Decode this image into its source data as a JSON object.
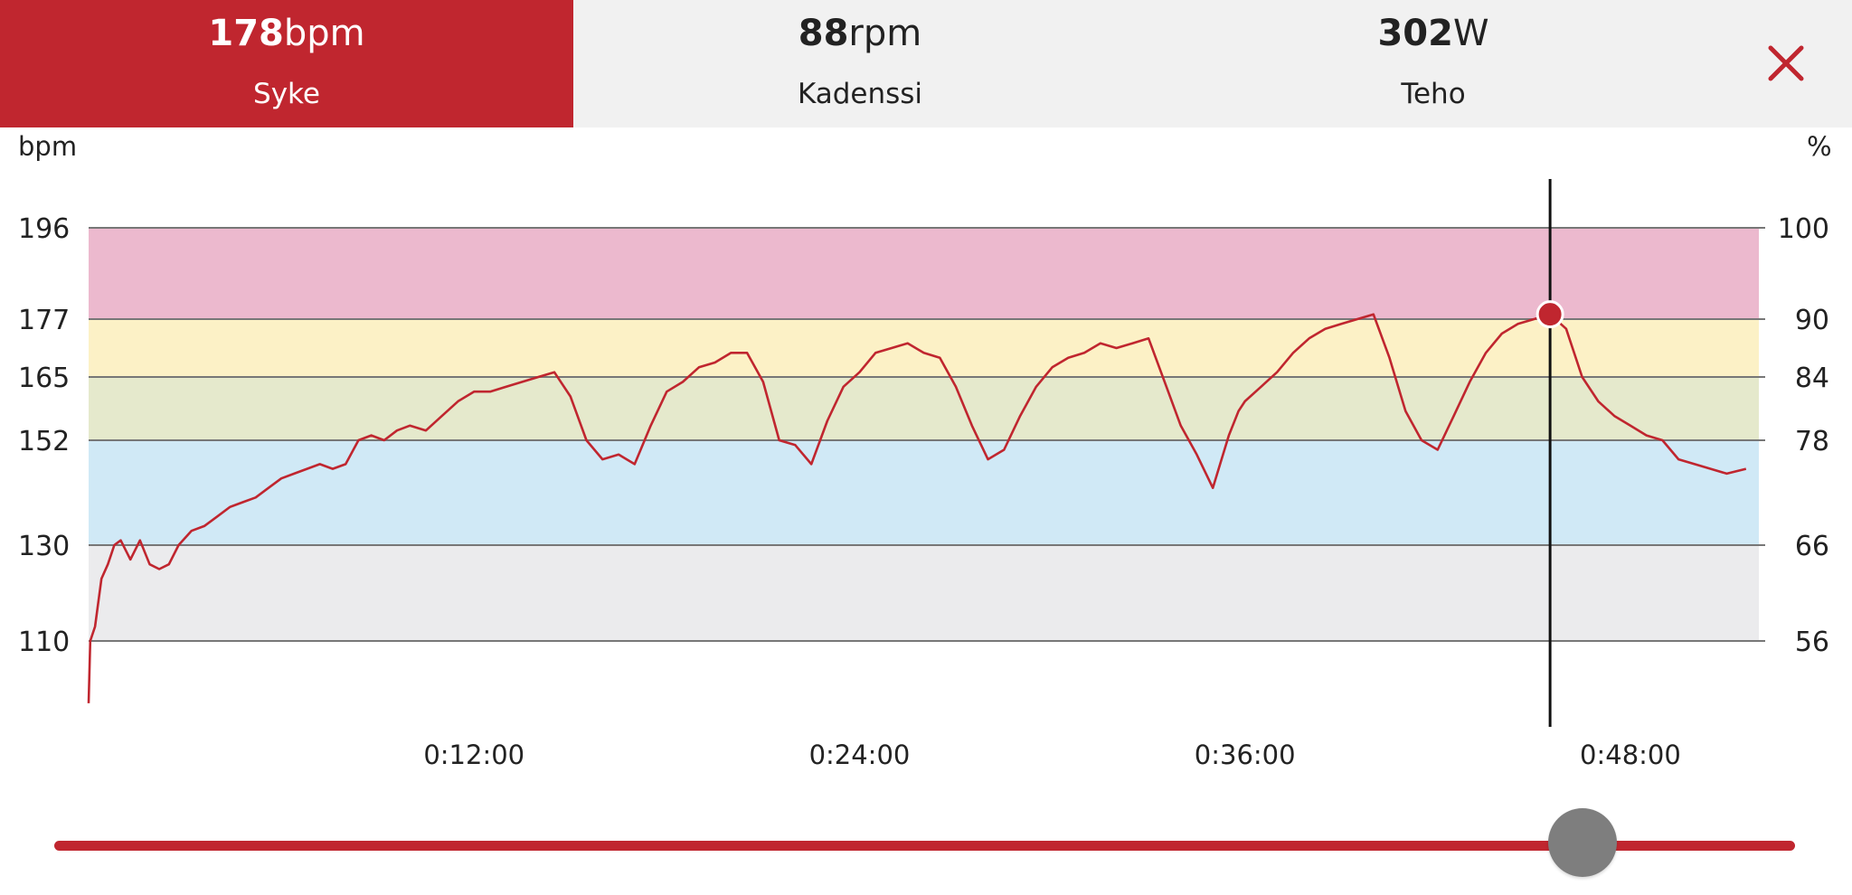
{
  "tabs": [
    {
      "value": "178",
      "unit": "bpm",
      "label": "Syke",
      "active": true
    },
    {
      "value": "88",
      "unit": "rpm",
      "label": "Kadenssi",
      "active": false
    },
    {
      "value": "302",
      "unit": "W",
      "label": "Teho",
      "active": false
    }
  ],
  "close_icon": "close-x-icon",
  "colors": {
    "accent": "#c0262f",
    "zone_max": "#ecb9ce",
    "zone_hard": "#fcf1c6",
    "zone_moderate": "#e5e9cc",
    "zone_light": "#d0e9f6",
    "zone_very_light": "#ebebed"
  },
  "chart_data": {
    "type": "line",
    "left_axis_label": "bpm",
    "right_axis_label": "%",
    "left_ticks": [
      196,
      177,
      165,
      152,
      130,
      110
    ],
    "right_ticks": [
      100,
      90,
      84,
      78,
      66,
      56
    ],
    "x_tick_labels": [
      "0:12:00",
      "0:24:00",
      "0:36:00",
      "0:48:00"
    ],
    "x_tick_values_min": [
      12,
      24,
      36,
      48
    ],
    "xlim_min": [
      0,
      52
    ],
    "ylim": [
      97,
      196
    ],
    "zones": [
      {
        "from": 177,
        "to": 196,
        "color": "#ecb9ce"
      },
      {
        "from": 165,
        "to": 177,
        "color": "#fcf1c6"
      },
      {
        "from": 152,
        "to": 165,
        "color": "#e5e9cc"
      },
      {
        "from": 130,
        "to": 152,
        "color": "#d0e9f6"
      },
      {
        "from": 110,
        "to": 130,
        "color": "#ebebed"
      }
    ],
    "series": [
      {
        "x_min": [
          0,
          0.05,
          0.2,
          0.4,
          0.6,
          0.8,
          1.0,
          1.3,
          1.6,
          1.9,
          2.2,
          2.5,
          2.8,
          3.2,
          3.6,
          4.0,
          4.4,
          4.8,
          5.2,
          5.6,
          6.0,
          6.4,
          6.8,
          7.2,
          7.6,
          8.0,
          8.4,
          8.8,
          9.2,
          9.6,
          10.0,
          10.5,
          11.0,
          11.5,
          12.0,
          12.5,
          13.0,
          13.5,
          14.0,
          14.5,
          15.0,
          15.5,
          16.0,
          16.5,
          17.0,
          17.5,
          18.0,
          18.5,
          19.0,
          19.5,
          20.0,
          20.5,
          21.0,
          21.5,
          22.0,
          22.5,
          23.0,
          23.5,
          24.0,
          24.5,
          25.0,
          25.5,
          26.0,
          26.5,
          27.0,
          27.5,
          28.0,
          28.5,
          29.0,
          29.5,
          30.0,
          30.5,
          31.0,
          31.5,
          32.0,
          32.5,
          33.0,
          33.5,
          34.0,
          34.5,
          35.0,
          35.5,
          35.8,
          36.0,
          36.5,
          37.0,
          37.5,
          38.0,
          38.5,
          39.0,
          39.5,
          40.0,
          40.5,
          41.0,
          41.5,
          42.0,
          42.5,
          43.0,
          43.5,
          44.0,
          44.5,
          45.0,
          45.5,
          46.0,
          46.5,
          47.0,
          47.5,
          48.0,
          48.5,
          49.0,
          49.5,
          50.0,
          50.5,
          51.0,
          51.6
        ],
        "values": [
          97,
          110,
          113,
          123,
          126,
          130,
          131,
          127,
          131,
          126,
          125,
          126,
          130,
          133,
          134,
          136,
          138,
          139,
          140,
          142,
          144,
          145,
          146,
          147,
          146,
          147,
          152,
          153,
          152,
          154,
          155,
          154,
          157,
          160,
          162,
          162,
          163,
          164,
          165,
          166,
          161,
          152,
          148,
          149,
          147,
          155,
          162,
          164,
          167,
          168,
          170,
          170,
          164,
          152,
          151,
          147,
          156,
          163,
          166,
          170,
          171,
          172,
          170,
          169,
          163,
          155,
          148,
          150,
          157,
          163,
          167,
          169,
          170,
          172,
          171,
          172,
          173,
          164,
          155,
          149,
          142,
          153,
          158,
          160,
          163,
          166,
          170,
          173,
          175,
          176,
          177,
          178,
          169,
          158,
          152,
          150,
          157,
          164,
          170,
          174,
          176,
          177,
          178,
          175,
          165,
          160,
          157,
          155,
          153,
          152,
          148,
          147,
          146,
          145,
          146
        ]
      }
    ],
    "cursor_time_min": 45.5,
    "cursor_value": 178
  },
  "slider": {
    "position_fraction": 0.878
  }
}
